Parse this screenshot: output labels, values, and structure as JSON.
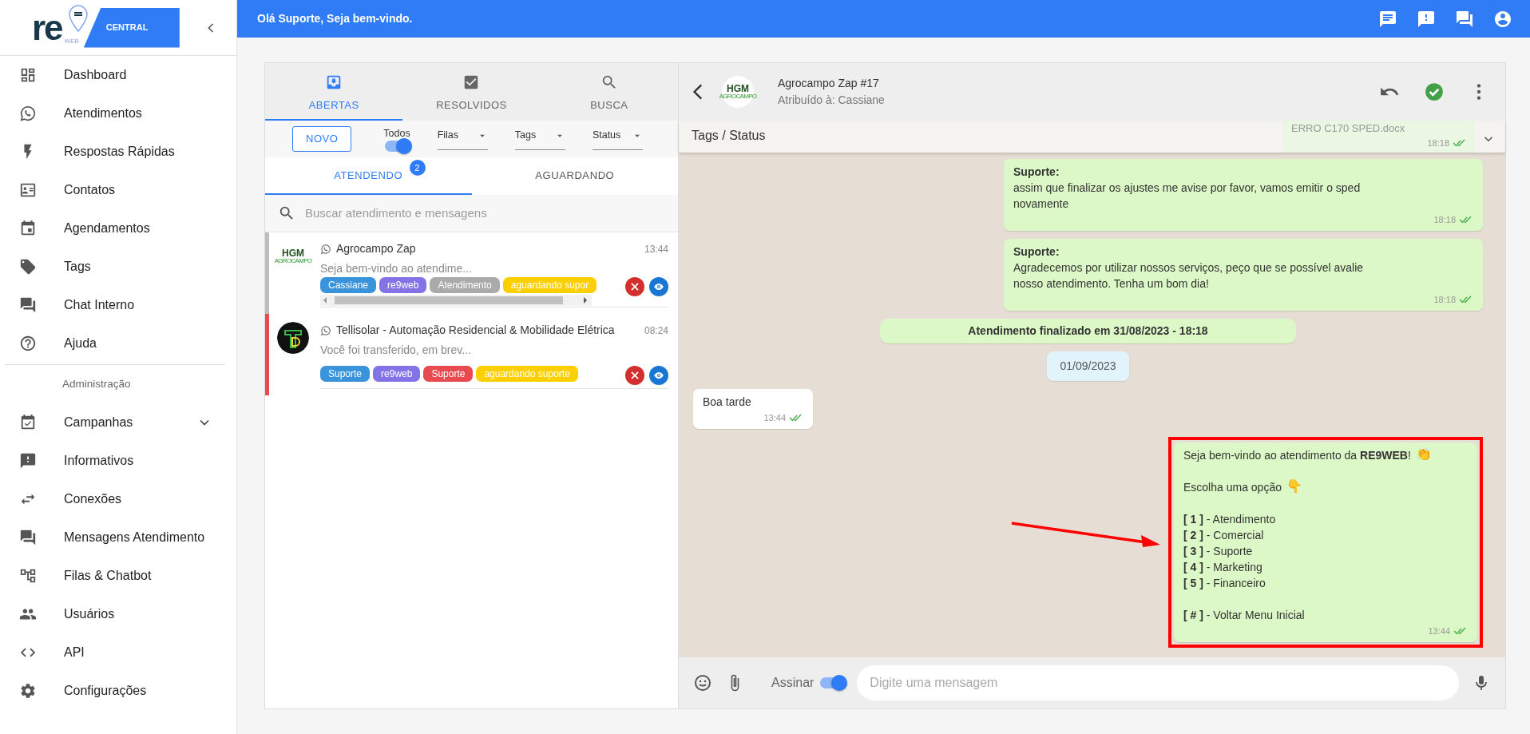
{
  "sidebar": {
    "logo": {
      "wordmark": "re",
      "sub": "WEB",
      "label": "CENTRAL"
    },
    "items": [
      {
        "label": "Dashboard",
        "kind": "link"
      },
      {
        "label": "Atendimentos",
        "kind": "link"
      },
      {
        "label": "Respostas Rápidas",
        "kind": "link"
      },
      {
        "label": "Contatos",
        "kind": "link"
      },
      {
        "label": "Agendamentos",
        "kind": "link"
      },
      {
        "label": "Tags",
        "kind": "link"
      },
      {
        "label": "Chat Interno",
        "kind": "link"
      },
      {
        "label": "Ajuda",
        "kind": "link"
      },
      {
        "label": "Administração",
        "kind": "header"
      },
      {
        "label": "Campanhas",
        "kind": "group",
        "expanded": false
      },
      {
        "label": "Informativos",
        "kind": "link"
      },
      {
        "label": "Conexões",
        "kind": "link"
      },
      {
        "label": "Mensagens Atendimento",
        "kind": "link"
      },
      {
        "label": "Filas & Chatbot",
        "kind": "link"
      },
      {
        "label": "Usuários",
        "kind": "link"
      },
      {
        "label": "API",
        "kind": "link"
      },
      {
        "label": "Configurações",
        "kind": "link"
      }
    ]
  },
  "topbar": {
    "greeting": "Olá Suporte, Seja bem-vindo."
  },
  "tickets_panel": {
    "tabs": [
      {
        "label": "ABERTAS",
        "selected": true
      },
      {
        "label": "RESOLVIDOS",
        "selected": false
      },
      {
        "label": "BUSCA",
        "selected": false
      }
    ],
    "new_button": "NOVO",
    "toggle": {
      "label": "Todos",
      "on": true
    },
    "selects": [
      {
        "label": "Filas"
      },
      {
        "label": "Tags"
      },
      {
        "label": "Status"
      }
    ],
    "subtabs": [
      {
        "label": "ATENDENDO",
        "selected": true,
        "badge": "2"
      },
      {
        "label": "AGUARDANDO",
        "selected": false
      }
    ],
    "search": {
      "placeholder": "Buscar atendimento e mensagens"
    },
    "tickets": [
      {
        "name": "Agrocampo Zap",
        "preview": "Seja bem-vindo ao atendime...",
        "time": "13:44",
        "color": "#bdbdbd",
        "avatar": {
          "kind": "logo",
          "title": "HGM",
          "subtitle": "AGROCAMPO"
        },
        "scrollbar": true,
        "tags": [
          {
            "label": "Cassiane",
            "color": "#3a94dc"
          },
          {
            "label": "re9web",
            "color": "#8274e6"
          },
          {
            "label": "Atendimento",
            "color": "#aaaaaa"
          },
          {
            "label": "aguardando supor",
            "color": "#fccf00"
          }
        ]
      },
      {
        "name": "Tellisolar - Automação Residencial & Mobilidade Elétrica",
        "preview": "Você foi transferido, em brev...",
        "time": "08:24",
        "color": "#e84a50",
        "avatar": {
          "kind": "emblem"
        },
        "scrollbar": false,
        "tags": [
          {
            "label": "Suporte",
            "color": "#3a94dc"
          },
          {
            "label": "re9web",
            "color": "#8274e6"
          },
          {
            "label": "Suporte",
            "color": "#e84a50"
          },
          {
            "label": "aguardando suporte",
            "color": "#fccf00"
          }
        ]
      }
    ]
  },
  "chat": {
    "header": {
      "title": "Agrocampo Zap #17",
      "subtitle": "Atribuído à: Cassiane",
      "avatar": {
        "kind": "logo",
        "title": "HGM",
        "subtitle": "AGROCAMPO"
      }
    },
    "tags_bar": {
      "label": "Tags / Status",
      "expanded": false
    },
    "messages": [
      {
        "kind": "file",
        "file_name": "ERRO C170 SPED.docx",
        "time": "18:18",
        "highlighted": false
      },
      {
        "kind": "outgoing",
        "sender": "Suporte:",
        "paragraphs": [
          {
            "lines": [
              {
                "text": "assim que finalizar os ajustes me avise por favor, vamos emitir o sped novamente"
              }
            ]
          }
        ],
        "time": "18:18",
        "highlighted": false
      },
      {
        "kind": "outgoing",
        "sender": "Suporte:",
        "paragraphs": [
          {
            "lines": [
              {
                "text": "Agradecemos por utilizar nossos serviços, peço que se possível avalie nosso atendimento. Tenha um bom dia!"
              }
            ]
          }
        ],
        "time": "18:18",
        "highlighted": false
      },
      {
        "kind": "system",
        "text": "Atendimento finalizado em 31/08/2023 - 18:18"
      },
      {
        "kind": "date",
        "text": "01/09/2023"
      },
      {
        "kind": "incoming",
        "paragraphs": [
          {
            "lines": [
              {
                "text": "Boa tarde"
              }
            ]
          }
        ],
        "time": "13:44",
        "highlighted": false
      },
      {
        "kind": "outgoing",
        "paragraphs": [
          {
            "lines": [
              {
                "text": "Seja bem-vindo ao atendimento da **RE9WEB**!",
                "emoji": "👏"
              }
            ]
          },
          {
            "lines": [
              {
                "text": "Escolha uma opção",
                "emoji": "👇"
              }
            ]
          },
          {
            "lines": [
              {
                "text": "**[ 1 ]** - Atendimento"
              },
              {
                "text": "**[ 2 ]** - Comercial"
              },
              {
                "text": "**[ 3 ]** - Suporte"
              },
              {
                "text": "**[ 4 ]** - Marketing"
              },
              {
                "text": "**[ 5 ]** - Financeiro"
              }
            ]
          },
          {
            "lines": [
              {
                "text": "**[ # ]** - Voltar Menu Inicial"
              }
            ]
          }
        ],
        "time": "13:44",
        "highlighted": true
      }
    ],
    "composer": {
      "signature": {
        "label": "Assinar",
        "on": true
      },
      "placeholder": "Digite uma mensagem"
    }
  }
}
